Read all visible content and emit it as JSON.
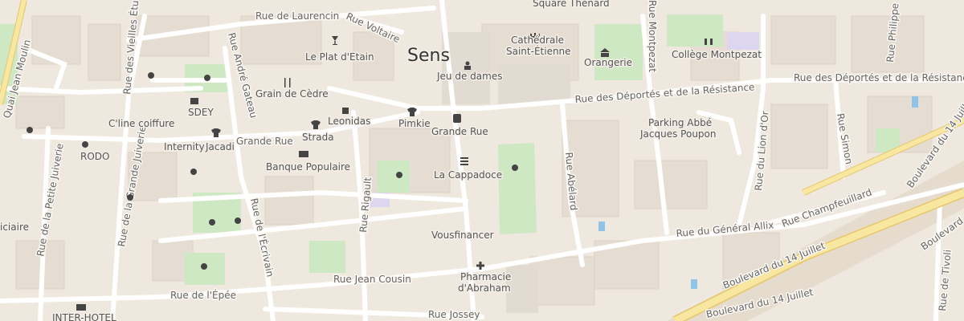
{
  "map": {
    "city": "Sens",
    "colors": {
      "land": "#efe8df",
      "street": "#ffffff",
      "park": "#cfe8c4",
      "square": "#e2dbd2",
      "rail": "#e6dccd",
      "lilac": "#ddd6f0",
      "water": "#8fc3e8",
      "boulevard": "#f8e7a0",
      "boulevard_edge": "#e7c56a"
    },
    "streets": {
      "rue_de_laurencin": "Rue de Laurencin",
      "rue_voltaire": "Rue Voltaire",
      "square_thenard": "Square Thénard",
      "rue_montpezat": "Rue Montpezat",
      "rue_philippe": "Rue Philippe",
      "quai_jean_moulin": "Quai Jean Moulin",
      "rue_des_vieilles_etuves": "Rue des Vieilles Étuves",
      "rue_andre_gateau": "Rue André Gateau",
      "rue_deportes": "Rue des Déportés et de la Résistance",
      "rue_deportes_2": "Rue des Déportés et de la Résistance",
      "grande_rue_street": "Grande Rue",
      "rue_du_lion_dor": "Rue du Lion d'Or",
      "rue_simon": "Rue Simon",
      "rue_de_la_petite_juiverie": "Rue de la Petite Juiverie",
      "rue_de_la_grande_juiverie": "Rue de la Grande Juiverie",
      "rue_de_lecrivain": "Rue de l'Écrivain",
      "rue_rigault": "Rue Rigault",
      "rue_abelard": "Rue Abélard",
      "rue_champfeuillard": "Rue Champfeuillard",
      "boulevard_du_14_juillet": "Boulevard du 14 Juillet",
      "boulevard_du_14_juillet_2": "Boulevard du 14 Juillet",
      "boulevard_du_14_juillet_3": "Boulevard du 14 Juillet",
      "boulevard_partial": "Boulevard",
      "rue_du_general_allix": "Rue du Général Allix",
      "rue_jean_cousin": "Rue Jean Cousin",
      "rue_de_lepee": "Rue de l'Épée",
      "rue_jossey": "Rue Jossey",
      "rue_de_tivoli": "Rue de Tivoli",
      "iciaire": "iciaire"
    },
    "pois": {
      "le_plat_detain": "Le Plat d'Etain",
      "cathedrale_1": "Cathédrale",
      "cathedrale_2": "Saint-Étienne",
      "orangerie": "Orangerie",
      "college": "Collège Montpezat",
      "jeu_de_dames": "Jeu de dames",
      "grain_de_cedre": "Grain de Cèdre",
      "sdey": "SDEY",
      "cline": "C'line coiffure",
      "leonidas": "Leonidas",
      "pimkie": "Pimkie",
      "grande_rue_bus": "Grande Rue",
      "parking_1": "Parking Abbé",
      "parking_2": "Jacques Poupon",
      "rodo": "RODO",
      "internity": "Internity",
      "jacadi": "Jacadi",
      "strada": "Strada",
      "banque_populaire": "Banque Populaire",
      "la_cappadoce": "La Cappadoce",
      "vousfinancer": "Vousfinancer",
      "pharmacie_1": "Pharmacie",
      "pharmacie_2": "d'Abraham",
      "inter_hotel": "INTER-HOTEL"
    }
  }
}
